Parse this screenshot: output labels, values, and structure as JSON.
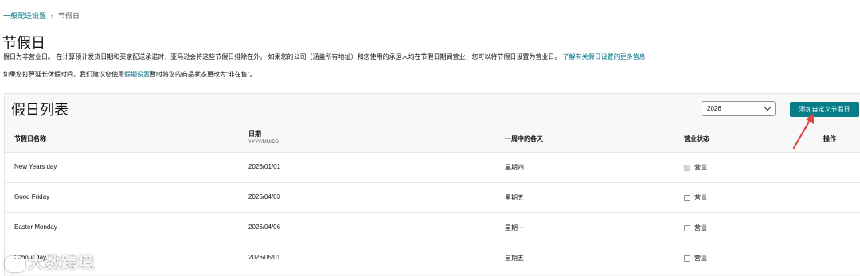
{
  "breadcrumb": {
    "parent": "一般配送设置",
    "separator": "›",
    "current": "节假日"
  },
  "page_title": "节假日",
  "description": {
    "line1": "假日为非营业日。 在计算预计发货日期和买家配送承诺时，亚马逊会将这些节假日排除在外。 如果您的公司（涵盖所有地址）和您使用的承运人均在节假日期间营业，您可以将节假日设置为营业日。",
    "line1_link": "了解有关假日设置的更多信息",
    "line2_prefix": "如果您打算延长休假时间，我们建议您使用",
    "line2_link": "假期设置",
    "line2_suffix": "暂时将您的商品状态更改为“非在售”。"
  },
  "holiday_list": {
    "title": "假日列表",
    "year_select": {
      "selected": "2026"
    },
    "add_button_label": "添加自定义节假日",
    "columns": {
      "name": "节假日名称",
      "date": "日期",
      "date_format": "YYYY/MM/DD",
      "weekday": "一周中的各天",
      "status": "营业状态",
      "actions": "操作"
    },
    "rows": [
      {
        "name": "New Years day",
        "date": "2026/01/01",
        "weekday": "星期四",
        "status": "营业"
      },
      {
        "name": "Good Friday",
        "date": "2026/04/03",
        "weekday": "星期五",
        "status": "营业"
      },
      {
        "name": "Easter Monday",
        "date": "2026/04/06",
        "weekday": "星期一",
        "status": "营业"
      },
      {
        "name": "Labour day",
        "date": "2026/05/01",
        "weekday": "星期五",
        "status": "营业"
      }
    ]
  },
  "watermark": {
    "text": "大数跨境"
  },
  "colors": {
    "accent": "#067d87",
    "link": "#007185",
    "annotation_arrow": "#e0463e"
  }
}
